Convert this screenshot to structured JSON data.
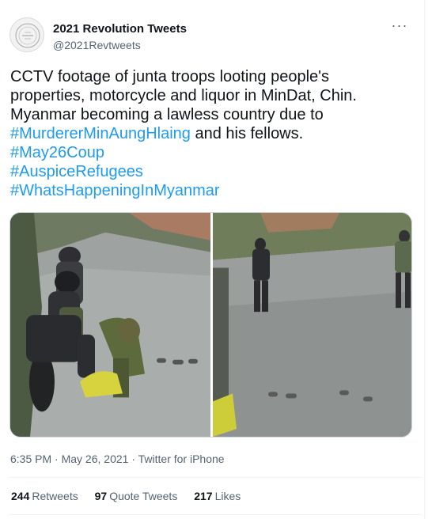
{
  "author": {
    "display_name": "2021 Revolution Tweets",
    "handle": "@2021Revtweets"
  },
  "tweet": {
    "line1": "CCTV footage of junta troops looting people's",
    "line2": "properties, motorcycle and liquor in MinDat, Chin.",
    "line3": "Myanmar becoming a lawless country due to",
    "hashtag1": "#MurdererMinAungHlaing",
    "line4_rest": " and his fellows.",
    "hashtag2": "#May26Coup",
    "hashtag3": "#AuspiceRefugees",
    "hashtag4": "#WhatsHappeningInMyanmar"
  },
  "media": {
    "left_alt": "CCTV still of soldiers on a motorcycle on a wet street",
    "right_alt": "CCTV still of soldiers walking on a wet street"
  },
  "meta": {
    "time": "6:35 PM",
    "sep1": " · ",
    "date": "May 26, 2021",
    "sep2": " · ",
    "source": "Twitter for iPhone"
  },
  "stats": {
    "retweets_count": "244",
    "retweets_label": "Retweets",
    "quotes_count": "97",
    "quotes_label": "Quote Tweets",
    "likes_count": "217",
    "likes_label": "Likes"
  },
  "icons": {
    "more": "more-icon",
    "avatar": "avatar-logo"
  },
  "colors": {
    "hashtag": "#1d9bf0",
    "secondary_text": "#536471"
  }
}
